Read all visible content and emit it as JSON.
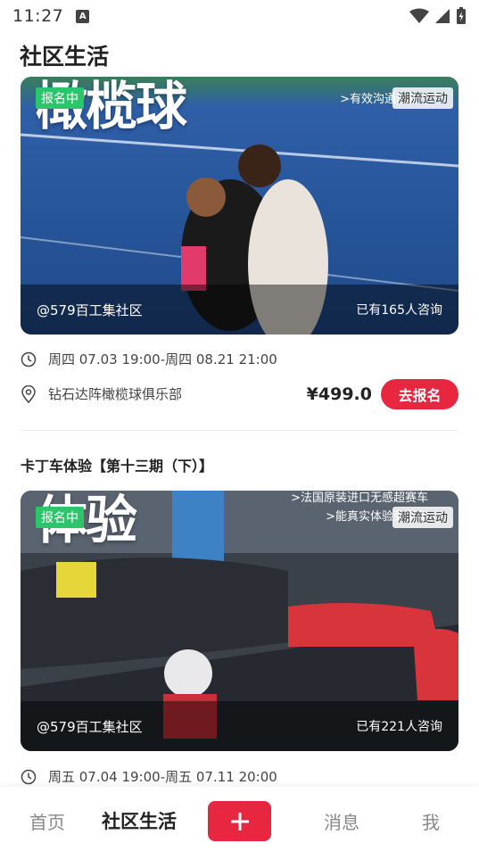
{
  "status_bar": {
    "time": "11:27",
    "notification_letter": "A"
  },
  "page": {
    "title": "社区生活"
  },
  "cards": [
    {
      "badge": "报名中",
      "big_title": "橄榄球",
      "caption_lines": [
        ">有效沟通和超"
      ],
      "tag": "潮流运动",
      "community": "@579百工集社区",
      "consult": "已有165人咨询",
      "time": "周四 07.03 19:00-周四 08.21 21:00",
      "location": "钻石达阵橄榄球俱乐部",
      "price": "¥499.0",
      "signup_label": "去报名"
    },
    {
      "title": "卡丁车体验【第十三期（下）】",
      "badge": "报名中",
      "big_title": "体验",
      "caption_lines": [
        ">法国原装进口无感超赛车",
        ">能真实体验到赛车"
      ],
      "tag": "潮流运动",
      "community": "@579百工集社区",
      "consult": "已有221人咨询",
      "time": "周五 07.04 19:00-周五 07.11 20:00"
    }
  ],
  "bottom_nav": {
    "home": "首页",
    "community": "社区生活",
    "messages": "消息",
    "me": "我"
  },
  "colors": {
    "accent": "#e8263f",
    "badge_green": "#2bc56b"
  }
}
